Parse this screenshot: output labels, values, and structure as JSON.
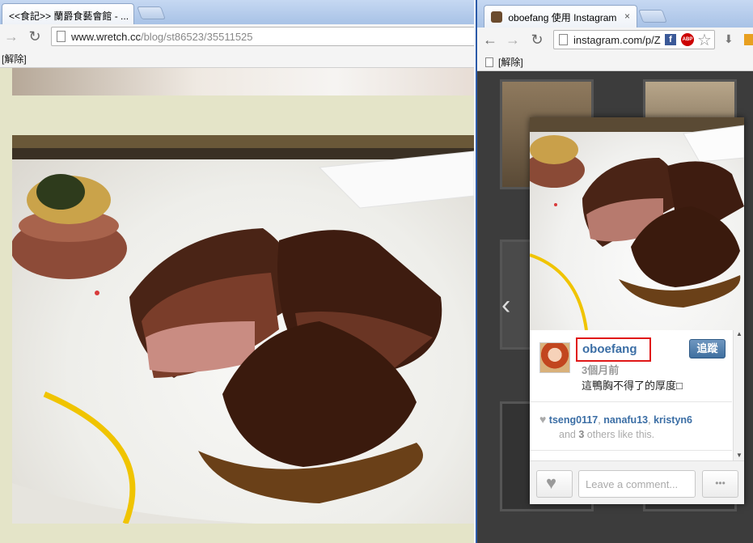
{
  "left_window": {
    "tab_title": "<<食記>> 蘭爵食藝會館 - ...",
    "url_domain": "www.wretch.cc",
    "url_path": "/blog/st86523/35511525",
    "bookmarks_label": "[解除]"
  },
  "right_window": {
    "tab_title": "oboefang 使用 Instagram",
    "url": "instagram.com/p/Z",
    "bookmarks_label": "[解除]",
    "post": {
      "username": "oboefang",
      "follow_label": "追蹤",
      "posted_ago": "3個月前",
      "caption": "這鴨胸不得了的厚度□",
      "likers": [
        "tseng0117",
        "nanafu13",
        "kristyn6"
      ],
      "others_prefix": "and",
      "others_count": "3",
      "others_suffix": "others like this.",
      "comment_placeholder": "Leave a comment...",
      "more_label": "•••"
    }
  },
  "colors": {
    "instagram_blue": "#3b6ea5",
    "highlight_red": "#e01818",
    "page_background": "#e4e4c8"
  }
}
